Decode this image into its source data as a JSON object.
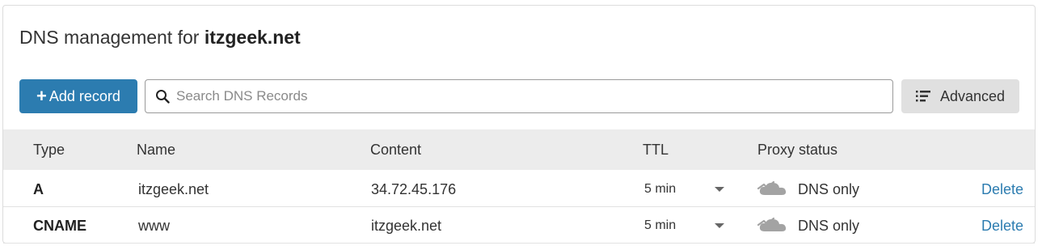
{
  "header": {
    "title_prefix": "DNS management for",
    "domain": "itzgeek.net"
  },
  "toolbar": {
    "add_label": "Add record",
    "add_plus": "+",
    "search_placeholder": "Search DNS Records",
    "search_value": "",
    "advanced_label": "Advanced"
  },
  "table": {
    "columns": [
      "Type",
      "Name",
      "Content",
      "TTL",
      "Proxy status"
    ],
    "rows": [
      {
        "type": "A",
        "name": "itzgeek.net",
        "content": "34.72.45.176",
        "ttl": "5 min",
        "proxy": "DNS only",
        "action": "Delete"
      },
      {
        "type": "CNAME",
        "name": "www",
        "content": "itzgeek.net",
        "ttl": "5 min",
        "proxy": "DNS only",
        "action": "Delete"
      }
    ]
  },
  "icons": {
    "search": "search-icon",
    "advanced": "list-filter-icon",
    "proxy": "dns-only-cloud-icon",
    "ttl": "caret-down-icon"
  },
  "colors": {
    "primary": "#2c7cb0",
    "header_bg": "#ececec",
    "button_grey": "#e0e0e0",
    "cloud": "#a3a3a3"
  }
}
